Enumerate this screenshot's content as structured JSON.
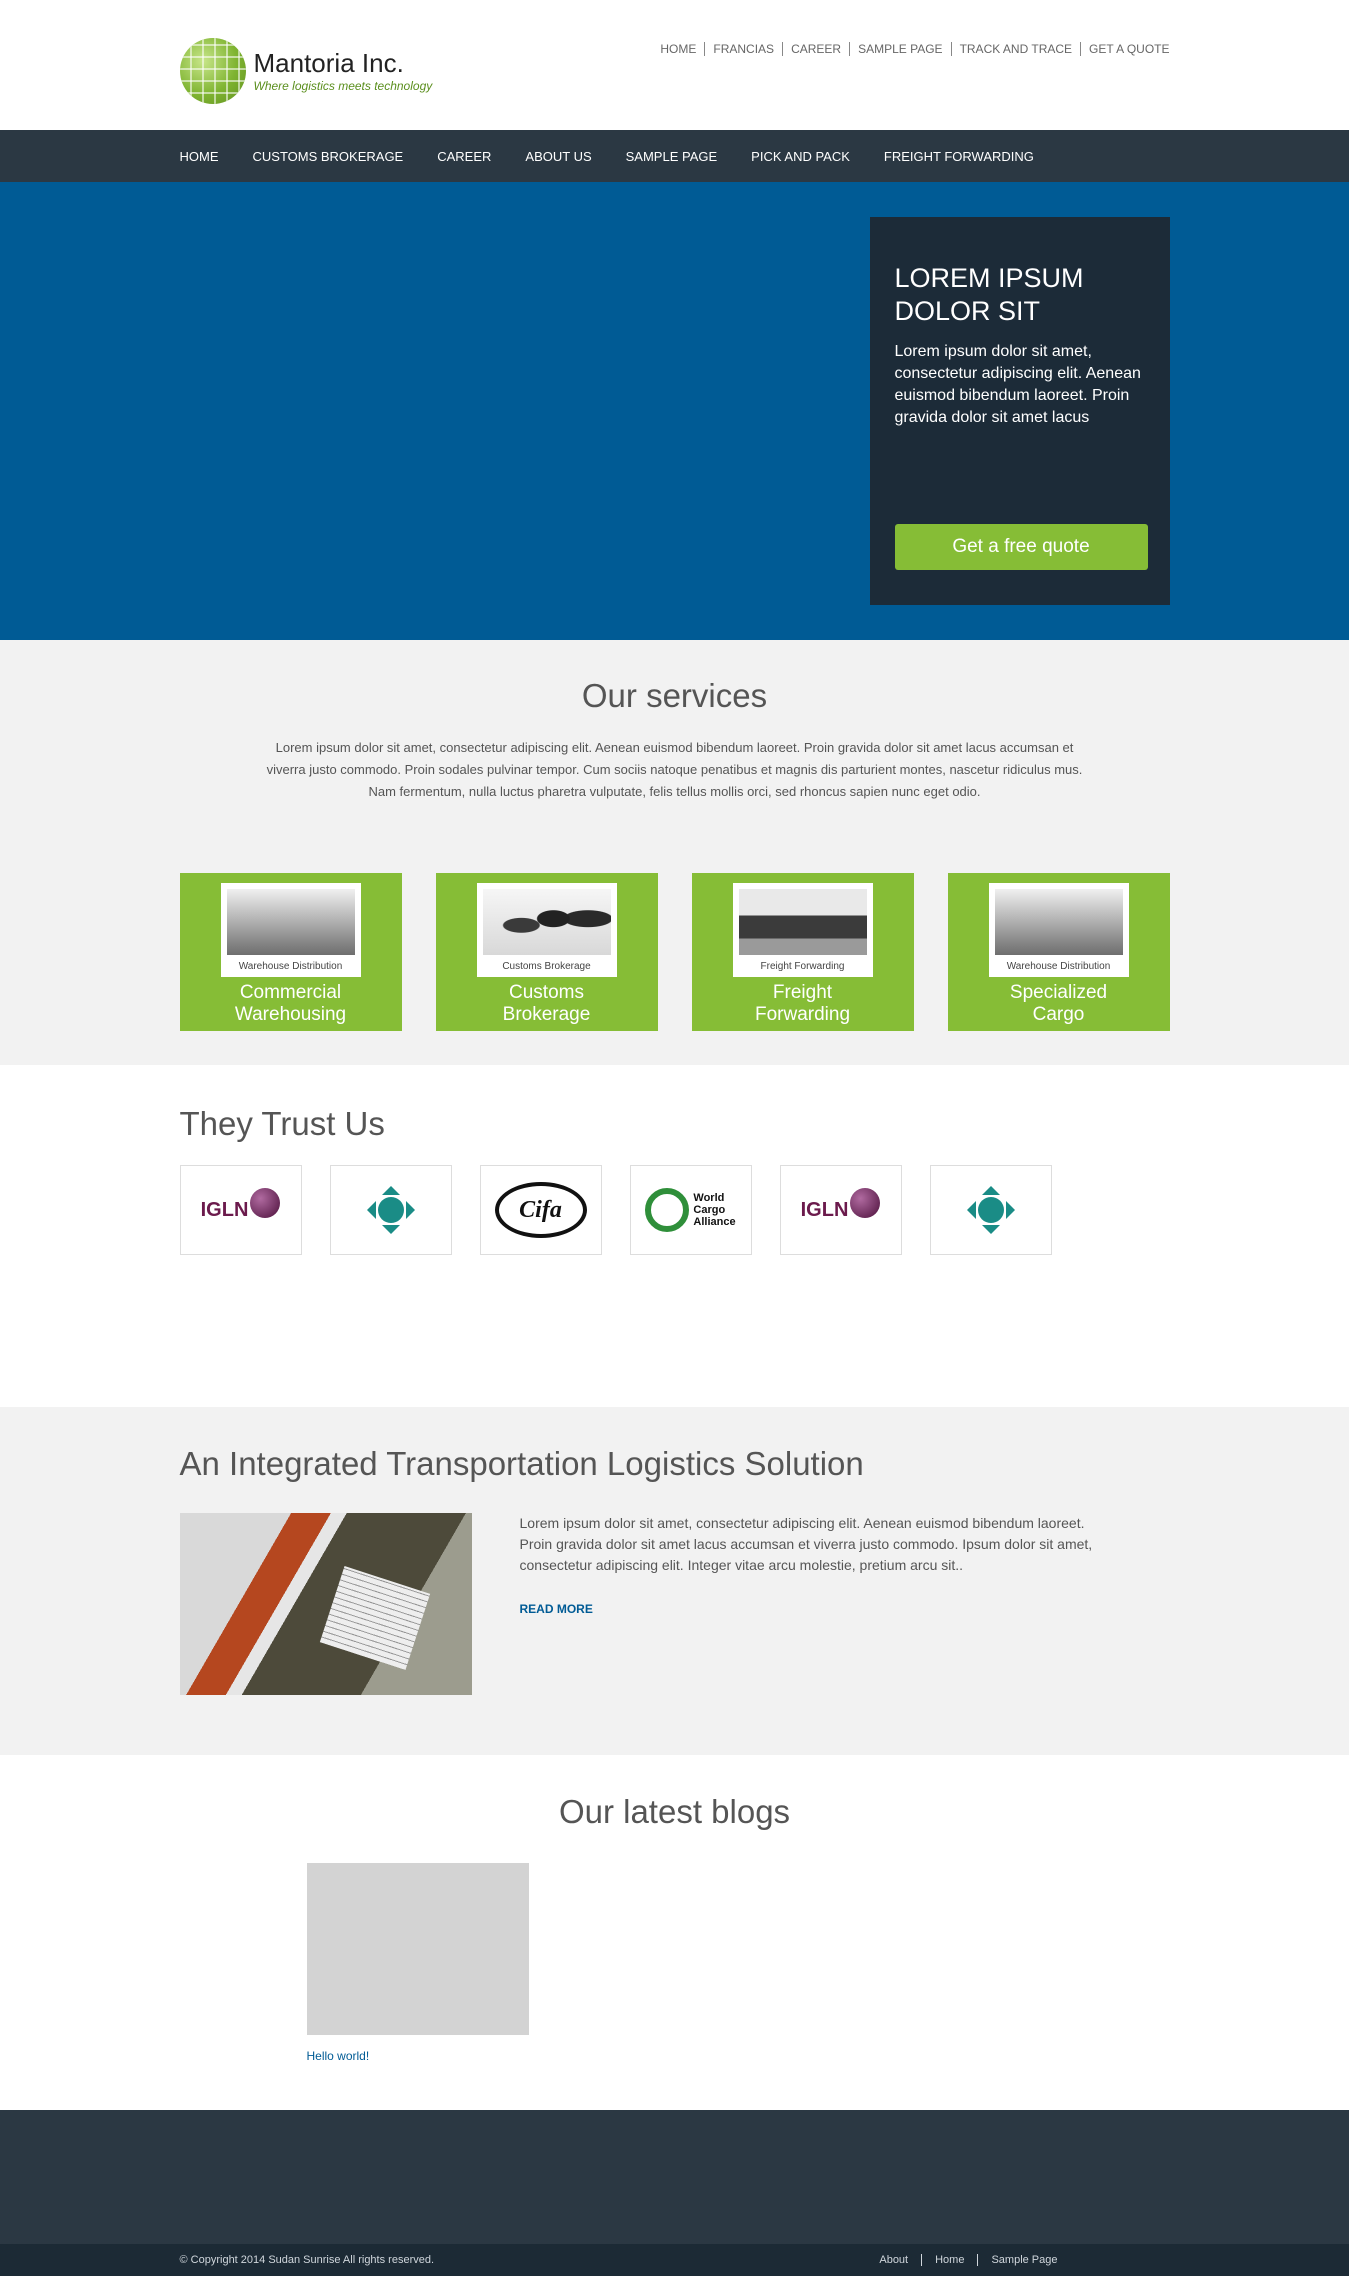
{
  "brand": {
    "name": "Mantoria Inc.",
    "tagline": "Where logistics meets technology"
  },
  "topnav": [
    "HOME",
    "FRANCIAS",
    "CAREER",
    "SAMPLE PAGE",
    "TRACK AND TRACE",
    "GET A QUOTE"
  ],
  "mainnav": [
    "HOME",
    "CUSTOMS BROKERAGE",
    "CAREER",
    "ABOUT US",
    "SAMPLE PAGE",
    "PICK AND PACK",
    "FREIGHT FORWARDING"
  ],
  "hero": {
    "title": "LOREM IPSUM DOLOR SIT",
    "text": "Lorem ipsum dolor sit amet, consectetur adipiscing elit. Aenean euismod bibendum laoreet. Proin gravida dolor sit amet lacus",
    "button": "Get a free quote"
  },
  "services": {
    "title": "Our services",
    "text": "Lorem ipsum dolor sit amet, consectetur adipiscing elit. Aenean euismod bibendum laoreet. Proin gravida dolor sit amet lacus accumsan et viverra justo commodo. Proin sodales pulvinar tempor. Cum sociis natoque penatibus et magnis dis parturient montes, nascetur ridiculus mus. Nam fermentum, nulla luctus pharetra vulputate, felis tellus mollis orci, sed rhoncus sapien nunc eget odio.",
    "cards": [
      {
        "caption": "Warehouse Distribution",
        "title_line1": "Commercial",
        "title_line2": "Warehousing"
      },
      {
        "caption": "Customs Brokerage",
        "title_line1": "Customs",
        "title_line2": "Brokerage"
      },
      {
        "caption": "Freight Forwarding",
        "title_line1": "Freight",
        "title_line2": "Forwarding"
      },
      {
        "caption": "Warehouse Distribution",
        "title_line1": "Specialized",
        "title_line2": "Cargo"
      }
    ]
  },
  "trust": {
    "title": "They Trust Us",
    "logos": [
      "IGLN",
      "globe-arrows",
      "Cifa",
      "World Cargo Alliance",
      "IGLN",
      "globe-arrows"
    ],
    "wca_lines": [
      "World",
      "Cargo",
      "Alliance"
    ]
  },
  "integrated": {
    "title": "An Integrated Transportation Logistics Solution",
    "text": "Lorem ipsum dolor sit amet, consectetur adipiscing elit. Aenean euismod bibendum laoreet. Proin gravida dolor sit amet lacus accumsan et viverra justo commodo. Ipsum dolor sit amet, consectetur adipiscing elit. Integer vitae arcu molestie, pretium arcu sit..",
    "link": "READ MORE"
  },
  "blogs": {
    "title": "Our latest blogs",
    "post_title": "Hello world!"
  },
  "footer": {
    "copyright": "© Copyright 2014 Sudan Sunrise All rights reserved.",
    "links": [
      "About",
      "Home",
      "Sample Page"
    ]
  },
  "colors": {
    "accent_green": "#86bd36",
    "hero_blue": "#005b95",
    "nav_dark": "#2b3843",
    "hero_box": "#1c2b38"
  }
}
